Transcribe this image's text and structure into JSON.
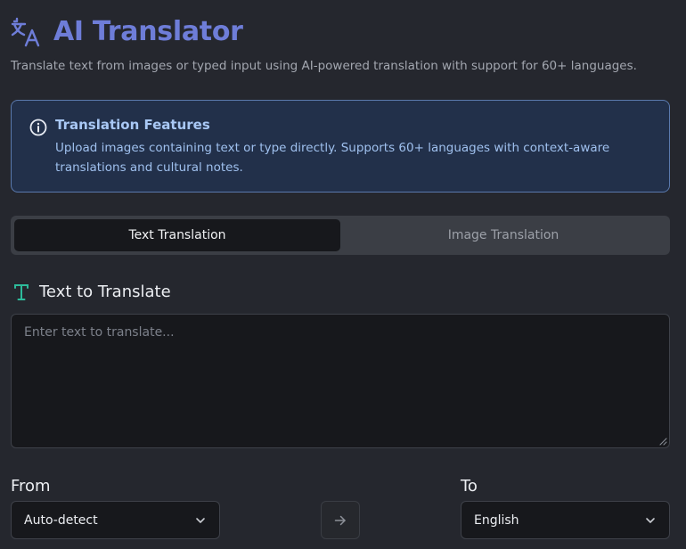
{
  "header": {
    "title": "AI Translator",
    "subtitle": "Translate text from images or typed input using AI-powered translation with support for 60+ languages.",
    "icon": "translate-icon",
    "title_color": "#6e7dd8"
  },
  "info_banner": {
    "icon": "info-icon",
    "title": "Translation Features",
    "text": "Upload images containing text or type directly. Supports 60+ languages with context-aware translations and cultural notes.",
    "border_color": "#5a79ad"
  },
  "tabs": [
    {
      "label": "Text Translation",
      "active": true
    },
    {
      "label": "Image Translation",
      "active": false
    }
  ],
  "input_section": {
    "icon": "type-icon",
    "label": "Text to Translate",
    "placeholder": "Enter text to translate...",
    "value": ""
  },
  "languages": {
    "from_label": "From",
    "from_value": "Auto-detect",
    "to_label": "To",
    "to_value": "English",
    "swap_icon": "arrow-right-icon"
  },
  "colors": {
    "background": "#25272e",
    "accent": "#6e7dd8",
    "teal_icon": "#2dbb9b",
    "info_text": "#9fc0ee"
  }
}
